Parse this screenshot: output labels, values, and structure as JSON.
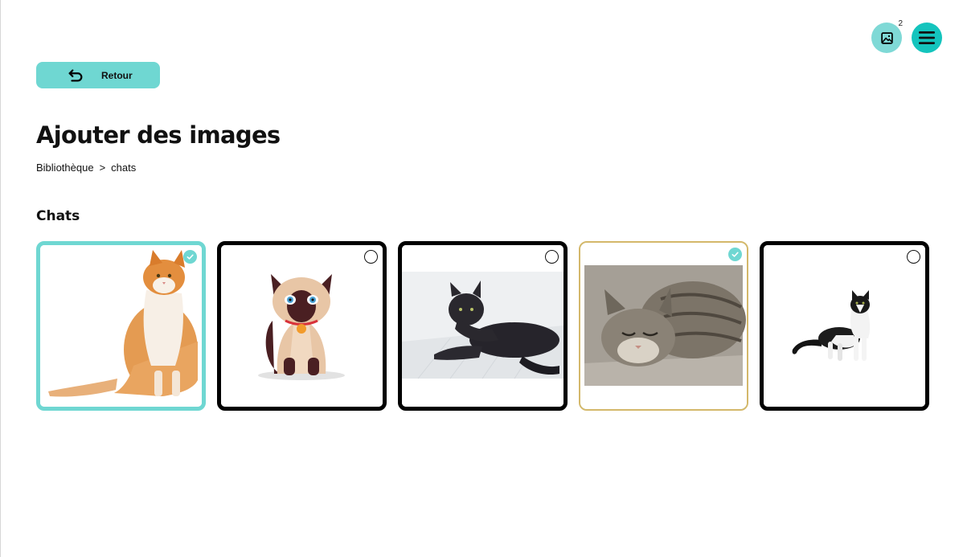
{
  "header": {
    "gallery_count": "2",
    "gallery_icon": "image-icon",
    "menu_icon": "hamburger-menu-icon"
  },
  "back_button": {
    "label": "Retour",
    "icon": "undo-arrow-icon"
  },
  "page": {
    "title": "Ajouter des images",
    "breadcrumb": {
      "root": "Bibliothèque",
      "separator": ">",
      "current": "chats"
    }
  },
  "section": {
    "title": "Chats"
  },
  "images": [
    {
      "subject": "orange and white cat sitting",
      "selected": true
    },
    {
      "subject": "cartoon siamese cat",
      "selected": false
    },
    {
      "subject": "black cat lying",
      "selected": false
    },
    {
      "subject": "tabby cat sleeping",
      "selected": true
    },
    {
      "subject": "black and white cat",
      "selected": false
    }
  ],
  "colors": {
    "accent": "#6fd7d2",
    "accent_strong": "#14c4bd",
    "card_border": "#000000",
    "text": "#111111"
  }
}
